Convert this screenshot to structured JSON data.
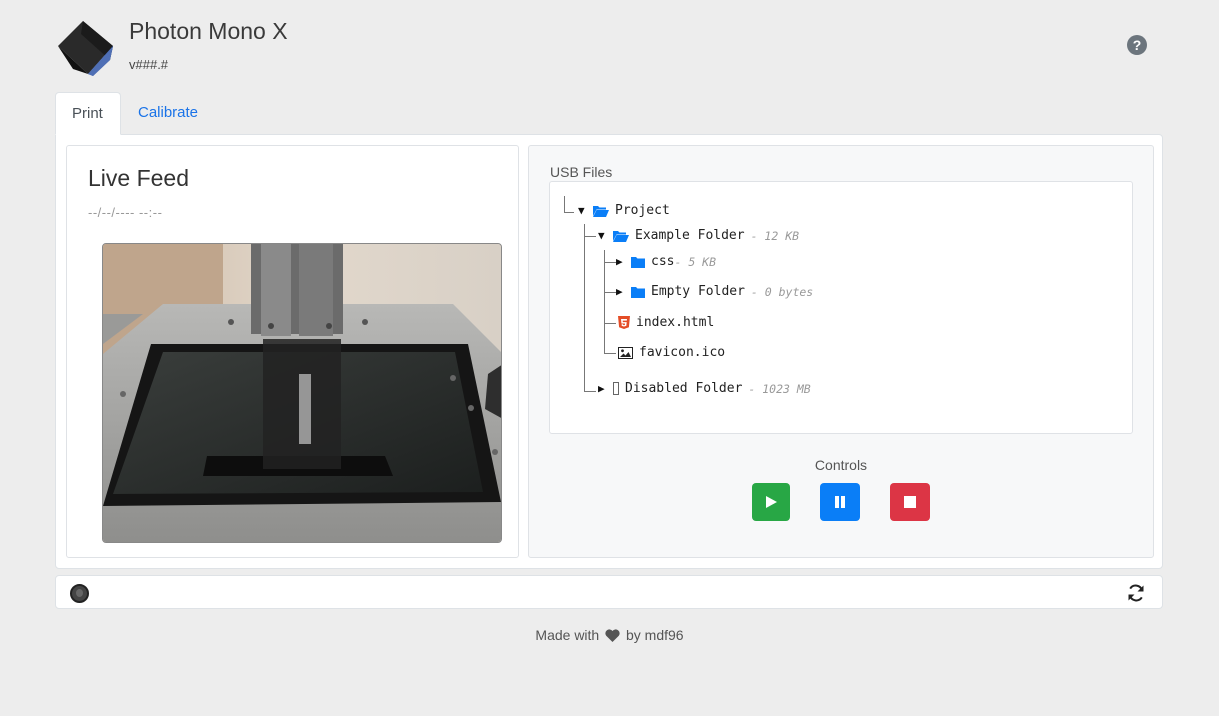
{
  "app": {
    "title": "Photon Mono X",
    "version": "v###.#",
    "help_glyph": "?",
    "logo_icon": "cube-logo-icon"
  },
  "tabs": [
    {
      "label": "Print",
      "active": true
    },
    {
      "label": "Calibrate",
      "active": false
    }
  ],
  "live_feed": {
    "title": "Live Feed",
    "timestamp": "--/--/---- --:--"
  },
  "usb": {
    "label": "USB Files",
    "tree": {
      "root": {
        "name": "Project",
        "icon": "folder-open-icon",
        "expanded": true
      },
      "example_folder": {
        "name": "Example Folder",
        "size": " - 12 KB",
        "icon": "folder-open-icon",
        "expanded": true
      },
      "css": {
        "name": "css",
        "size": "- 5 KB",
        "icon": "folder-icon",
        "expanded": false
      },
      "empty_folder": {
        "name": "Empty Folder",
        "size": " - 0 bytes",
        "icon": "folder-icon",
        "expanded": false
      },
      "index_html": {
        "name": "index.html",
        "icon": "html5-icon"
      },
      "favicon": {
        "name": "favicon.ico",
        "icon": "image-icon"
      },
      "disabled_folder": {
        "name": "Disabled Folder",
        "size": " - 1023 MB",
        "icon": "folder-disabled-icon",
        "expanded": false
      }
    }
  },
  "controls": {
    "label": "Controls",
    "buttons": [
      {
        "name": "play",
        "icon": "play-icon",
        "color": "#28a745"
      },
      {
        "name": "pause",
        "icon": "pause-icon",
        "color": "#0a7ef7"
      },
      {
        "name": "stop",
        "icon": "stop-icon",
        "color": "#dc3545"
      }
    ]
  },
  "status": {
    "indicator_icon": "status-indicator-icon",
    "refresh_icon": "refresh-icon"
  },
  "footer": {
    "prefix": "Made with",
    "suffix": "by mdf96"
  },
  "colors": {
    "accent": "#1a73e8",
    "folder": "#0a7ef7",
    "html5": "#e44d26"
  }
}
